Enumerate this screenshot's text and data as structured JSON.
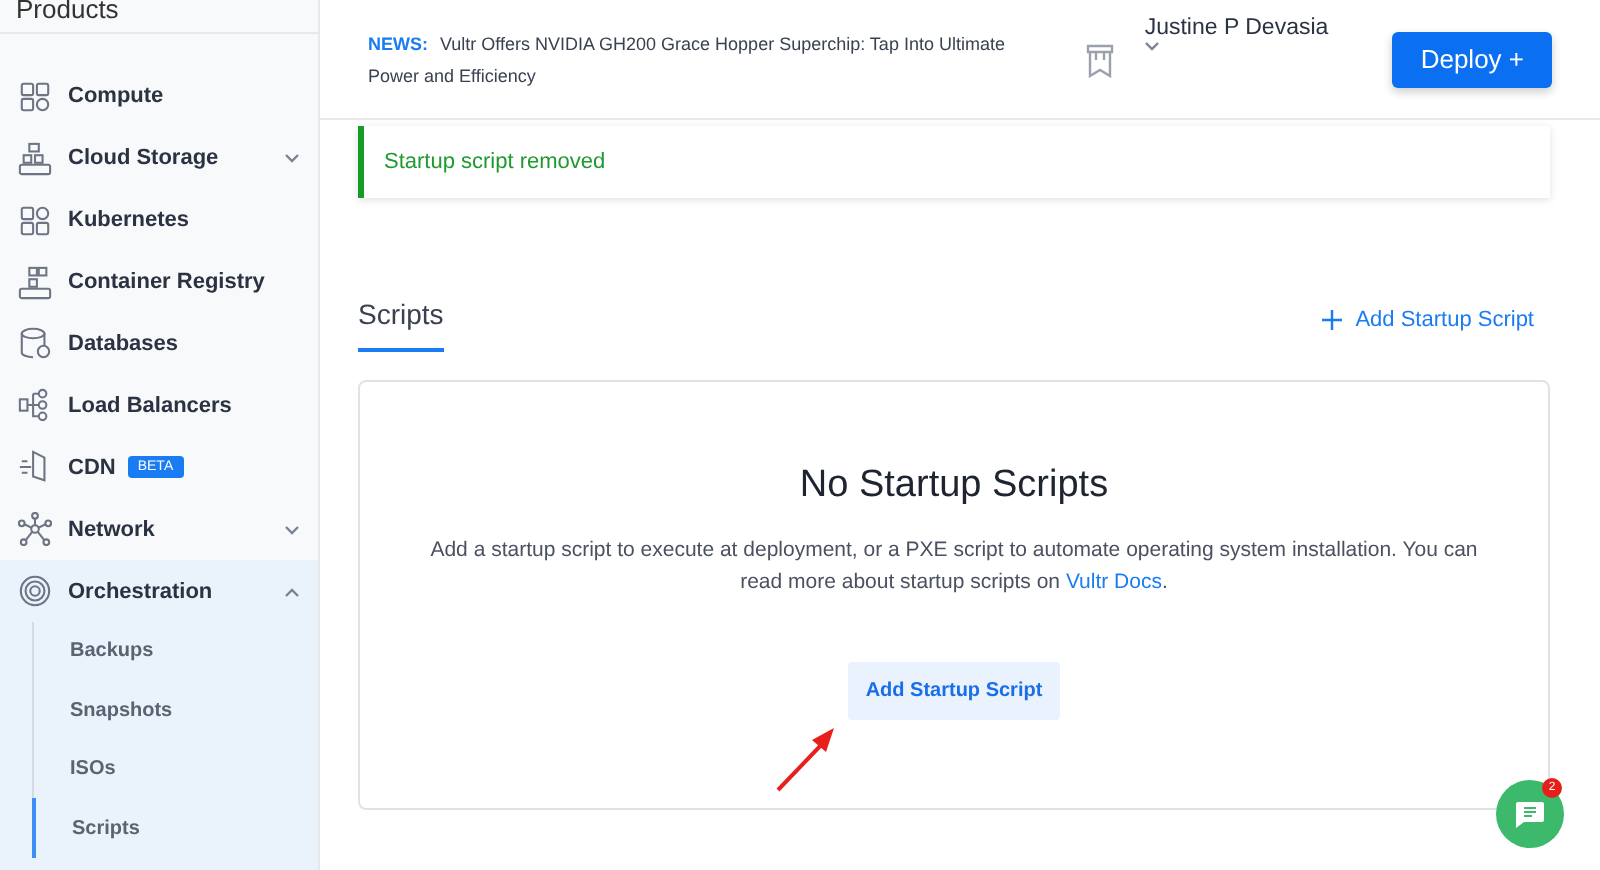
{
  "sidebar": {
    "heading": "Products",
    "items": [
      {
        "label": "Compute"
      },
      {
        "label": "Cloud Storage",
        "expanded": false
      },
      {
        "label": "Kubernetes"
      },
      {
        "label": "Container Registry"
      },
      {
        "label": "Databases"
      },
      {
        "label": "Load Balancers"
      },
      {
        "label": "CDN",
        "badge": "BETA"
      },
      {
        "label": "Network",
        "expanded": false
      },
      {
        "label": "Orchestration",
        "expanded": true,
        "children": [
          {
            "label": "Backups",
            "selected": false
          },
          {
            "label": "Snapshots",
            "selected": false
          },
          {
            "label": "ISOs",
            "selected": false
          },
          {
            "label": "Scripts",
            "selected": true
          }
        ]
      }
    ]
  },
  "header": {
    "news_label": "NEWS:",
    "news_text": "Vultr Offers NVIDIA GH200 Grace Hopper Superchip: Tap Into Ultimate Power and Efficiency",
    "user_name": "Justine P Devasia",
    "deploy_button": "Deploy +"
  },
  "alert": {
    "message": "Startup script removed"
  },
  "tabs": [
    {
      "label": "Scripts",
      "selected": true
    }
  ],
  "add_link": "Add Startup Script",
  "empty_state": {
    "title": "No Startup Scripts",
    "description": "Add a startup script to execute at deployment, or a PXE script to automate operating system installation. You can read more about startup scripts on ",
    "link": "Vultr Docs",
    "description_end": ".",
    "button": "Add Startup Script"
  },
  "chat": {
    "badge": "2"
  }
}
